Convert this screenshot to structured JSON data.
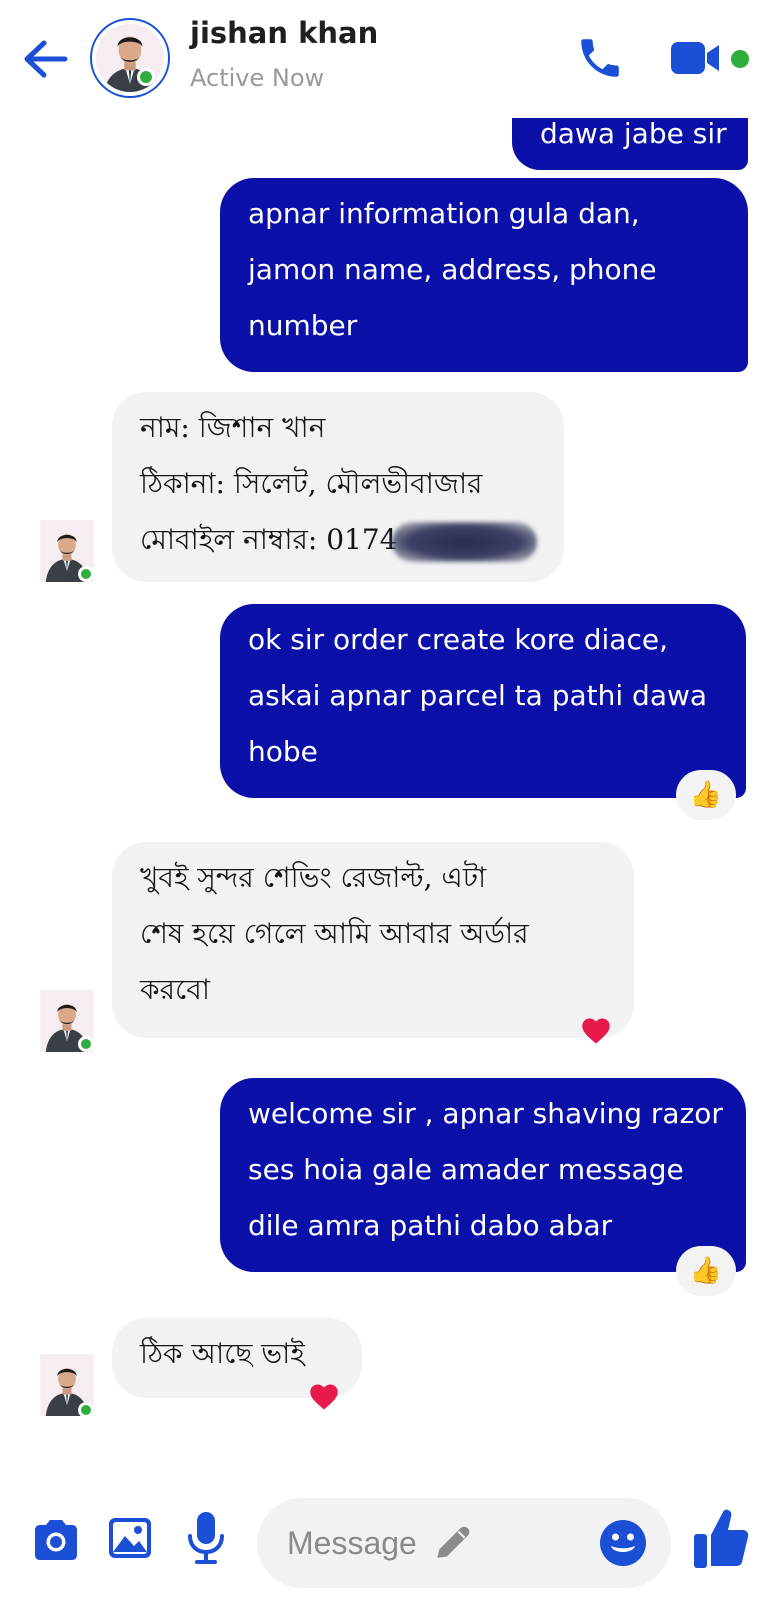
{
  "header": {
    "contact_name": "jishan khan",
    "status": "Active Now"
  },
  "messages": [
    {
      "direction": "out",
      "lines": [
        "dawa jabe sir"
      ]
    },
    {
      "direction": "out",
      "lines": [
        "apnar information gula dan,",
        "jamon name, address, phone",
        "number"
      ]
    },
    {
      "direction": "in",
      "lines": [
        "নাম: জিশান খান",
        "ঠিকানা: সিলেট, মৌলভীবাজার",
        "মোবাইল নাম্বার: 0174"
      ]
    },
    {
      "direction": "out",
      "lines": [
        "ok sir order create kore diace,",
        "askai apnar parcel ta pathi dawa",
        "hobe"
      ],
      "reaction": "👍"
    },
    {
      "direction": "in",
      "lines": [
        "খুবই সুন্দর শেভিং রেজাল্ট, এটা",
        "শেষ হয়ে গেলে আমি আবার অর্ডার",
        "করবো"
      ],
      "reaction": "heart"
    },
    {
      "direction": "out",
      "lines": [
        "welcome sir , apnar shaving razor",
        "ses hoia gale amader message",
        "dile amra pathi dabo abar"
      ],
      "reaction": "👍"
    },
    {
      "direction": "in",
      "lines": [
        "ঠিক আছে ভাই"
      ],
      "reaction": "heart"
    }
  ],
  "composer": {
    "placeholder": "Message"
  },
  "colors": {
    "accent": "#1a4fd6",
    "outgoing_bubble": "#0a10a8",
    "incoming_bubble": "#f2f2f4",
    "online": "#2fae3c",
    "heart": "#e8194b"
  },
  "icons": [
    "back-arrow-icon",
    "phone-icon",
    "video-camera-icon",
    "camera-icon",
    "image-icon",
    "microphone-icon",
    "pencil-icon",
    "emoji-icon",
    "thumbs-up-icon",
    "heart-icon"
  ]
}
